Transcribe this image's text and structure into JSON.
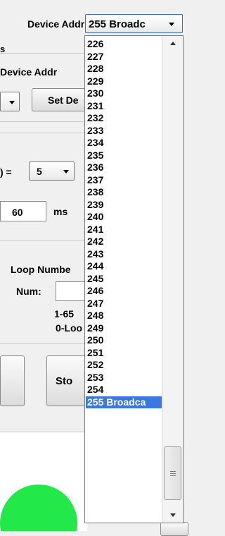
{
  "header": {
    "device_addr_label": "Device Addr",
    "selected_value": "255 Broadc"
  },
  "left_panel": {
    "section_title_fragment": "s",
    "device_addr_button": "Device Addr",
    "set_button": "Set De",
    "eq_label": ") =",
    "eq_value": "5",
    "interval_value": "60",
    "interval_unit": "ms",
    "loop_label": "Loop Numbe",
    "num_label": "Num:",
    "range_line1": "1-65",
    "range_line2": "0-Loo",
    "stop_button": "Sto"
  },
  "dropdown": {
    "items": [
      "226",
      "227",
      "228",
      "229",
      "230",
      "231",
      "232",
      "233",
      "234",
      "235",
      "236",
      "237",
      "238",
      "239",
      "240",
      "241",
      "242",
      "243",
      "244",
      "245",
      "246",
      "247",
      "248",
      "249",
      "250",
      "251",
      "252",
      "253",
      "254",
      "255 Broadca"
    ],
    "selected_index": 29
  },
  "colors": {
    "selection": "#3a78e0",
    "indicator": "#22e84a"
  }
}
